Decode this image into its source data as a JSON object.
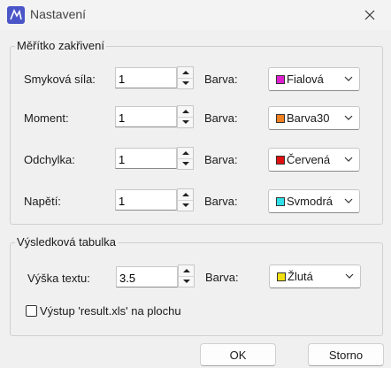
{
  "window": {
    "title": "Nastavení"
  },
  "scale_group": {
    "title": "Měřítko zakřivení",
    "rows": [
      {
        "label": "Smyková síla:",
        "value": "1",
        "color_label": "Barva:",
        "color_name": "Fialová",
        "swatch": "#e020d0"
      },
      {
        "label": "Moment:",
        "value": "1",
        "color_label": "Barva:",
        "color_name": "Barva30",
        "swatch": "#f08020"
      },
      {
        "label": "Odchylka:",
        "value": "1",
        "color_label": "Barva:",
        "color_name": "Červená",
        "swatch": "#e01010"
      },
      {
        "label": "Napětí:",
        "value": "1",
        "color_label": "Barva:",
        "color_name": "Svmodrá",
        "swatch": "#30e0e8"
      }
    ]
  },
  "result_group": {
    "title": "Výsledková tabulka",
    "text_height_label": "Výška textu:",
    "text_height_value": "3.5",
    "color_label": "Barva:",
    "color_name": "Žlutá",
    "swatch": "#f0e010",
    "export_label": "Výstup 'result.xls' na plochu",
    "export_checked": false
  },
  "buttons": {
    "ok": "OK",
    "cancel": "Storno"
  },
  "icons": {
    "app": "app-icon",
    "close": "close-icon",
    "spin_up": "chevron-up-icon",
    "spin_down": "chevron-down-icon",
    "dropdown": "chevron-down-icon"
  }
}
